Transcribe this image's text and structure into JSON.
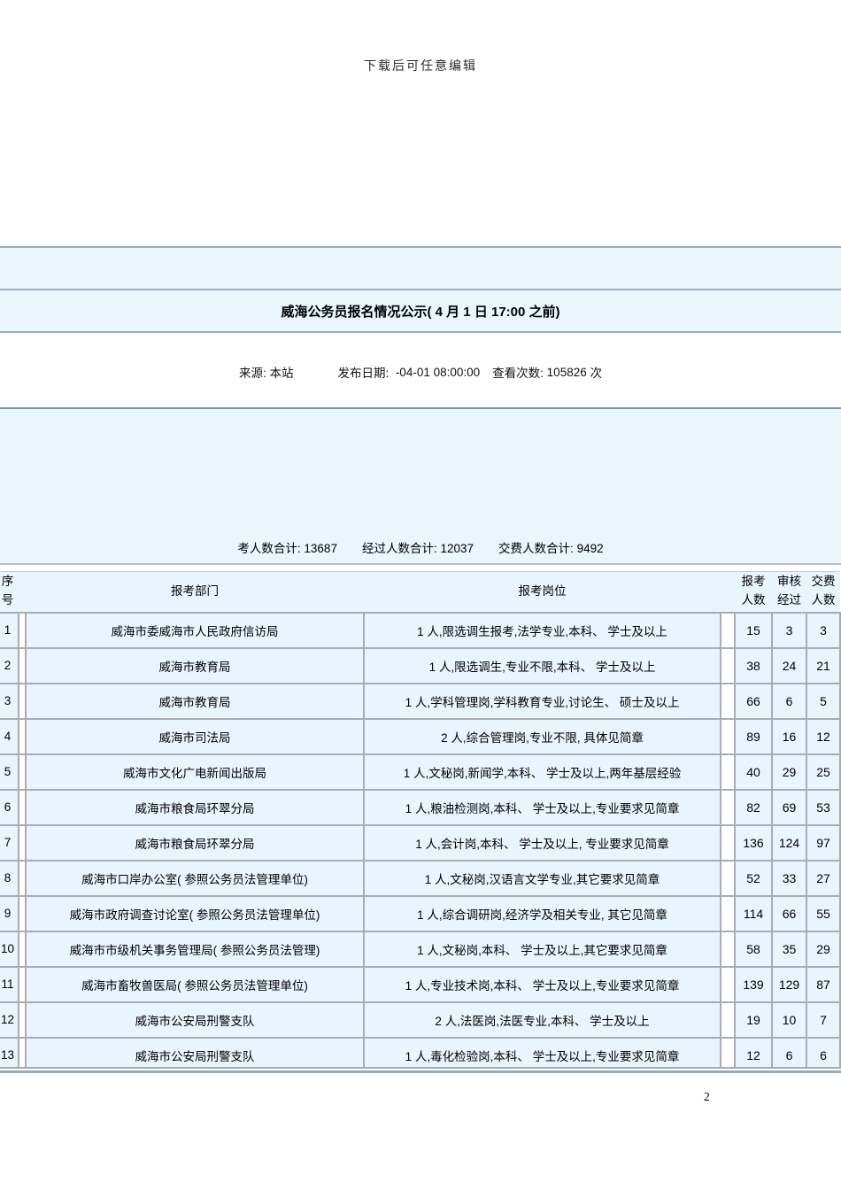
{
  "page": {
    "watermark": "下载后可任意编辑",
    "page_number": "2"
  },
  "article": {
    "title": "威海公务员报名情况公示( 4 月 1 日 17:00 之前)",
    "source_label": "来源:",
    "source_value": "本站",
    "publish_label": "发布日期:",
    "publish_value": "-04-01 08:00:00",
    "views_label": "查看次数:",
    "views_value": "105826",
    "views_unit": "次"
  },
  "summary": {
    "applicants_total_label": "考人数合计:",
    "applicants_total_value": "13687",
    "passed_total_label": "经过人数合计:",
    "passed_total_value": "12037",
    "paid_total_label": "交费人数合计:",
    "paid_total_value": "9492"
  },
  "table": {
    "headers": {
      "index": "序号",
      "department": "报考部门",
      "position": "报考岗位",
      "applicants": [
        "报考",
        "人数"
      ],
      "audit": [
        "审核",
        "经过"
      ],
      "paid": [
        "交费",
        "人数"
      ]
    },
    "rows": [
      {
        "no": "1",
        "department": "威海市委威海市人民政府信访局",
        "position": "1 人,限选调生报考,法学专业,本科、 学士及以上",
        "applicants": "15",
        "audit": "3",
        "paid": "3"
      },
      {
        "no": "2",
        "department": "威海市教育局",
        "position": "1 人,限选调生,专业不限,本科、 学士及以上",
        "applicants": "38",
        "audit": "24",
        "paid": "21"
      },
      {
        "no": "3",
        "department": "威海市教育局",
        "position": "1 人,学科管理岗,学科教育专业,讨论生、 硕士及以上",
        "applicants": "66",
        "audit": "6",
        "paid": "5"
      },
      {
        "no": "4",
        "department": "威海市司法局",
        "position": "2 人,综合管理岗,专业不限, 具体见简章",
        "applicants": "89",
        "audit": "16",
        "paid": "12"
      },
      {
        "no": "5",
        "department": "威海市文化广电新闻出版局",
        "position": "1 人,文秘岗,新闻学,本科、 学士及以上,两年基层经验",
        "applicants": "40",
        "audit": "29",
        "paid": "25"
      },
      {
        "no": "6",
        "department": "威海市粮食局环翠分局",
        "position": "1 人,粮油检测岗,本科、 学士及以上,专业要求见简章",
        "applicants": "82",
        "audit": "69",
        "paid": "53"
      },
      {
        "no": "7",
        "department": "威海市粮食局环翠分局",
        "position": "1 人,会计岗,本科、 学士及以上, 专业要求见简章",
        "applicants": "136",
        "audit": "124",
        "paid": "97"
      },
      {
        "no": "8",
        "department": "威海市口岸办公室( 参照公务员法管理单位)",
        "position": "1 人,文秘岗,汉语言文学专业,其它要求见简章",
        "applicants": "52",
        "audit": "33",
        "paid": "27"
      },
      {
        "no": "9",
        "department": "威海市政府调查讨论室( 参照公务员法管理单位)",
        "position": "1 人,综合调研岗,经济学及相关专业, 其它见简章",
        "applicants": "114",
        "audit": "66",
        "paid": "55"
      },
      {
        "no": "10",
        "department": "威海市市级机关事务管理局( 参照公务员法管理)",
        "position": "1 人,文秘岗,本科、 学士及以上,其它要求见简章",
        "applicants": "58",
        "audit": "35",
        "paid": "29"
      },
      {
        "no": "11",
        "department": "威海市畜牧兽医局( 参照公务员法管理单位)",
        "position": "1 人,专业技术岗,本科、 学士及以上,专业要求见简章",
        "applicants": "139",
        "audit": "129",
        "paid": "87"
      },
      {
        "no": "12",
        "department": "威海市公安局刑警支队",
        "position": "2 人,法医岗,法医专业,本科、 学士及以上",
        "applicants": "19",
        "audit": "10",
        "paid": "7"
      },
      {
        "no": "13",
        "department": "威海市公安局刑警支队",
        "position": "1 人,毒化检验岗,本科、 学士及以上,专业要求见简章",
        "applicants": "12",
        "audit": "6",
        "paid": "6"
      }
    ]
  },
  "colors": {
    "band_background": "#eaf5fc",
    "band_border": "#8fafc4",
    "stats_band_top_border": "#6e9ab0",
    "table_grid": "#a7adb2",
    "cell_background": "#e9f5fc",
    "bottom_rule_steel": "#8cabc6"
  }
}
